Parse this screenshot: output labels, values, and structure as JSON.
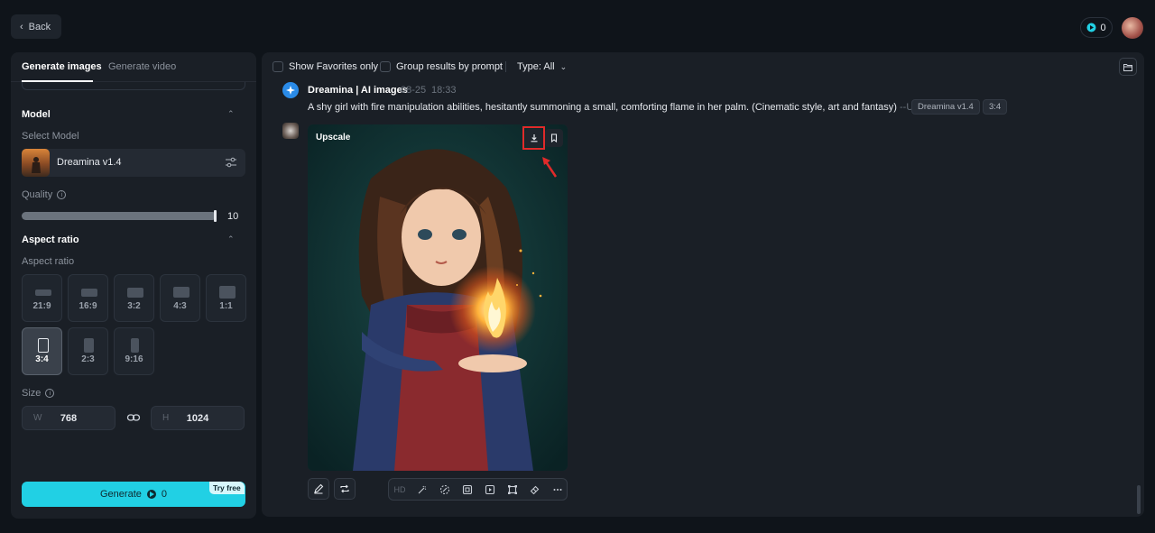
{
  "header": {
    "back_label": "Back",
    "credits": "0"
  },
  "left_panel": {
    "tabs": [
      {
        "label": "Generate images",
        "active": true
      },
      {
        "label": "Generate video",
        "active": false
      }
    ],
    "model": {
      "section_title": "Model",
      "select_label": "Select Model",
      "name": "Dreamina v1.4"
    },
    "quality": {
      "label": "Quality",
      "value": "10",
      "fraction": 1.0
    },
    "aspect_ratio": {
      "section_title": "Aspect ratio",
      "sub_label": "Aspect ratio",
      "options": [
        "21:9",
        "16:9",
        "3:2",
        "4:3",
        "1:1",
        "3:4",
        "2:3",
        "9:16"
      ],
      "selected": "3:4"
    },
    "size": {
      "label": "Size",
      "width_key": "W",
      "width": "768",
      "height_key": "H",
      "height": "1024"
    },
    "generate": {
      "label": "Generate",
      "cost": "0",
      "badge": "Try free"
    }
  },
  "right_panel": {
    "filters": {
      "favorites": "Show Favorites only",
      "group": "Group results by prompt",
      "type": "Type: All"
    },
    "message": {
      "sender": "Dreamina | AI images",
      "date": "08-25",
      "time": "18:33",
      "prompt": "A shy girl with fire manipulation abilities, hesitantly summoning a small, comforting flame in her palm. (Cinematic style, art and fantasy)",
      "suffix": "--Upscaled",
      "tags": [
        "Dreamina v1.4",
        "3:4"
      ]
    },
    "result": {
      "label": "Upscale"
    },
    "toolbar": {
      "hd_label": "HD"
    }
  },
  "colors": {
    "accent": "#21d0e4",
    "highlight": "#e12a2a",
    "background": "#0f141a",
    "panel": "#1a1f26"
  }
}
